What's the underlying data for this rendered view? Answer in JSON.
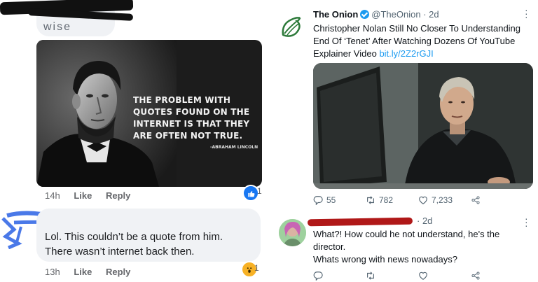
{
  "facebook": {
    "top_comment_fragment": "wise",
    "meme": {
      "quote": "THE PROBLEM WITH QUOTES FOUND ON THE INTERNET IS THAT THEY ARE OFTEN NOT TRUE.",
      "author": "-ABRAHAM LINCOLN"
    },
    "post_meta": {
      "time": "14h",
      "like_label": "Like",
      "reply_label": "Reply",
      "reaction_count": "1",
      "reaction_icon": "thumbs-up-icon"
    },
    "comment": {
      "line1": "Lol. This couldn’t be a quote from him.",
      "line2": "There wasn’t internet back then."
    },
    "comment_meta": {
      "time": "13h",
      "like_label": "Like",
      "reply_label": "Reply",
      "reaction_count": "1",
      "reaction_icon": "wow-icon"
    },
    "colors": {
      "like_blue": "#1877f2",
      "wow_yellow": "#f7b125",
      "bubble": "#f0f2f5"
    }
  },
  "twitter": {
    "tweet": {
      "display_name": "The Onion",
      "handle": "@TheOnion",
      "time": "· 2d",
      "text": "Christopher Nolan Still No Closer To Understanding End Of ‘Tenet’ After Watching Dozens Of YouTube Explainer Video ",
      "link": "bit.ly/2Z2rGJI",
      "replies": "55",
      "retweets": "782",
      "likes": "7,233"
    },
    "reply": {
      "time": "· 2d",
      "line1": "What?! How could he not understand, he's the",
      "line2": "director.",
      "line3": "Whats wrong with news nowadays?"
    },
    "colors": {
      "link_blue": "#1d9bf0",
      "onion_green": "#2d7a3a",
      "redaction_red": "#b01818"
    }
  }
}
